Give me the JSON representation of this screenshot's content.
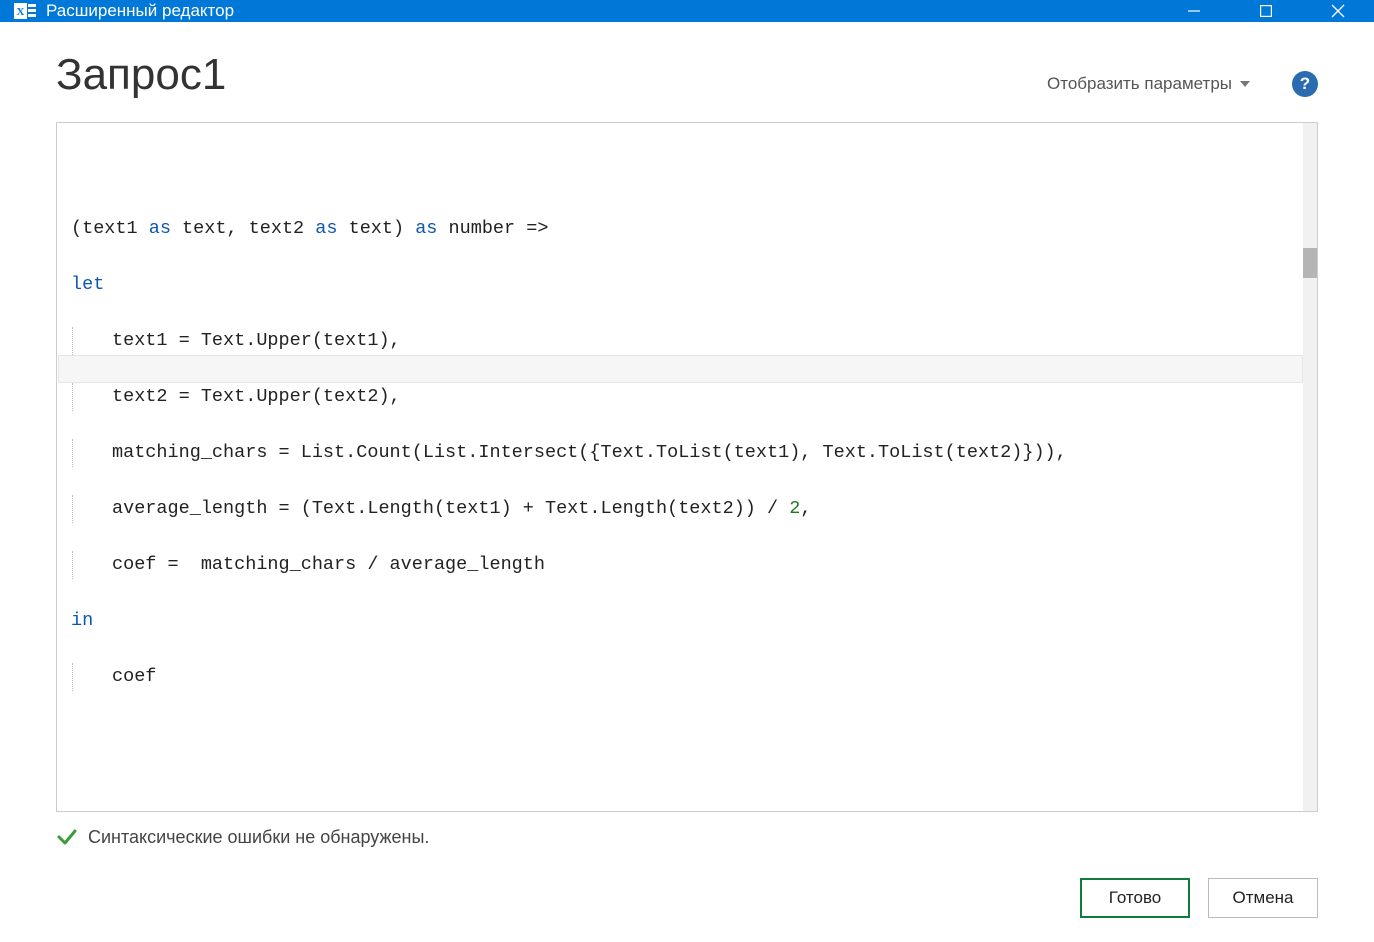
{
  "window": {
    "title": "Расширенный редактор"
  },
  "header": {
    "page_title": "Запрос1",
    "display_params_label": "Отобразить параметры",
    "help_symbol": "?"
  },
  "code": {
    "line1": {
      "p1": "(text1 ",
      "kw_as1": "as",
      "p2": " text, text2 ",
      "kw_as2": "as",
      "p3": " text) ",
      "kw_as3": "as",
      "p4": " number =>"
    },
    "line2_kw": "let",
    "line3": "text1 = Text.Upper(text1),",
    "line4": "text2 = Text.Upper(text2),",
    "line5": "matching_chars = List.Count(List.Intersect({Text.ToList(text1), Text.ToList(text2)})),",
    "line6": {
      "p1": "average_length = (Text.Length(text1) + Text.Length(text2)) / ",
      "num": "2",
      "p2": ","
    },
    "line7": "coef =  matching_chars / average_length",
    "line8_kw": "in",
    "line9": "coef"
  },
  "status": {
    "message": "Синтаксические ошибки не обнаружены."
  },
  "buttons": {
    "done": "Готово",
    "cancel": "Отмена"
  }
}
